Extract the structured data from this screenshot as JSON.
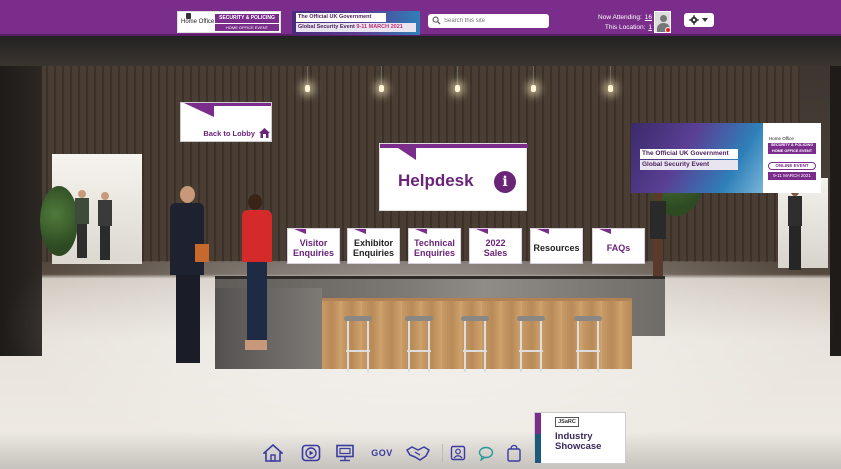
{
  "header": {
    "homeoffice_text": "Home Office",
    "logo_line1": "SECURITY & POLICING",
    "logo_line2": "HOME OFFICE EVENT",
    "banner_line1": "The Official UK Government",
    "banner_line2": "Global Security Event",
    "banner_date": "9-11 MARCH 2021",
    "search_placeholder": "Search this site",
    "now_attending_label": "Now Attending:",
    "now_attending_count": "16",
    "this_location_label": "This Location:",
    "this_location_count": "1"
  },
  "scene": {
    "back_to_lobby": "Back to Lobby",
    "helpdesk_title": "Helpdesk",
    "helpdesk_info_glyph": "i"
  },
  "menu": [
    {
      "label_l1": "Visitor",
      "label_l2": "Enquiries"
    },
    {
      "label_l1": "Exhibitor",
      "label_l2": "Enquiries"
    },
    {
      "label_l1": "Technical",
      "label_l2": "Enquiries"
    },
    {
      "label_l1": "2022",
      "label_l2": "Sales"
    },
    {
      "label_l1": "Resources",
      "label_l2": ""
    },
    {
      "label_l1": "FAQs",
      "label_l2": ""
    }
  ],
  "event_banner": {
    "line1": "The Official UK Government",
    "line2": "Global Security Event",
    "homeoffice": "Home Office",
    "sp_line1": "SECURITY & POLICING",
    "sp_line2": "HOME OFFICE EVENT",
    "online": "ONLINE EVENT",
    "date": "9-11 MARCH 2021"
  },
  "showcase": {
    "logo": "JSaRC",
    "title_l1": "Industry",
    "title_l2": "Showcase"
  },
  "toolbar": {
    "gov_label": "GOV",
    "icons": [
      "home-icon",
      "video-icon",
      "presentation-icon",
      "gov-icon",
      "handshake-icon",
      "contact-card-icon",
      "chat-icon",
      "bag-icon"
    ]
  },
  "colors": {
    "brand_purple": "#7b2d8b",
    "accent_pink": "#c0307a",
    "text_purple": "#6a2478"
  }
}
